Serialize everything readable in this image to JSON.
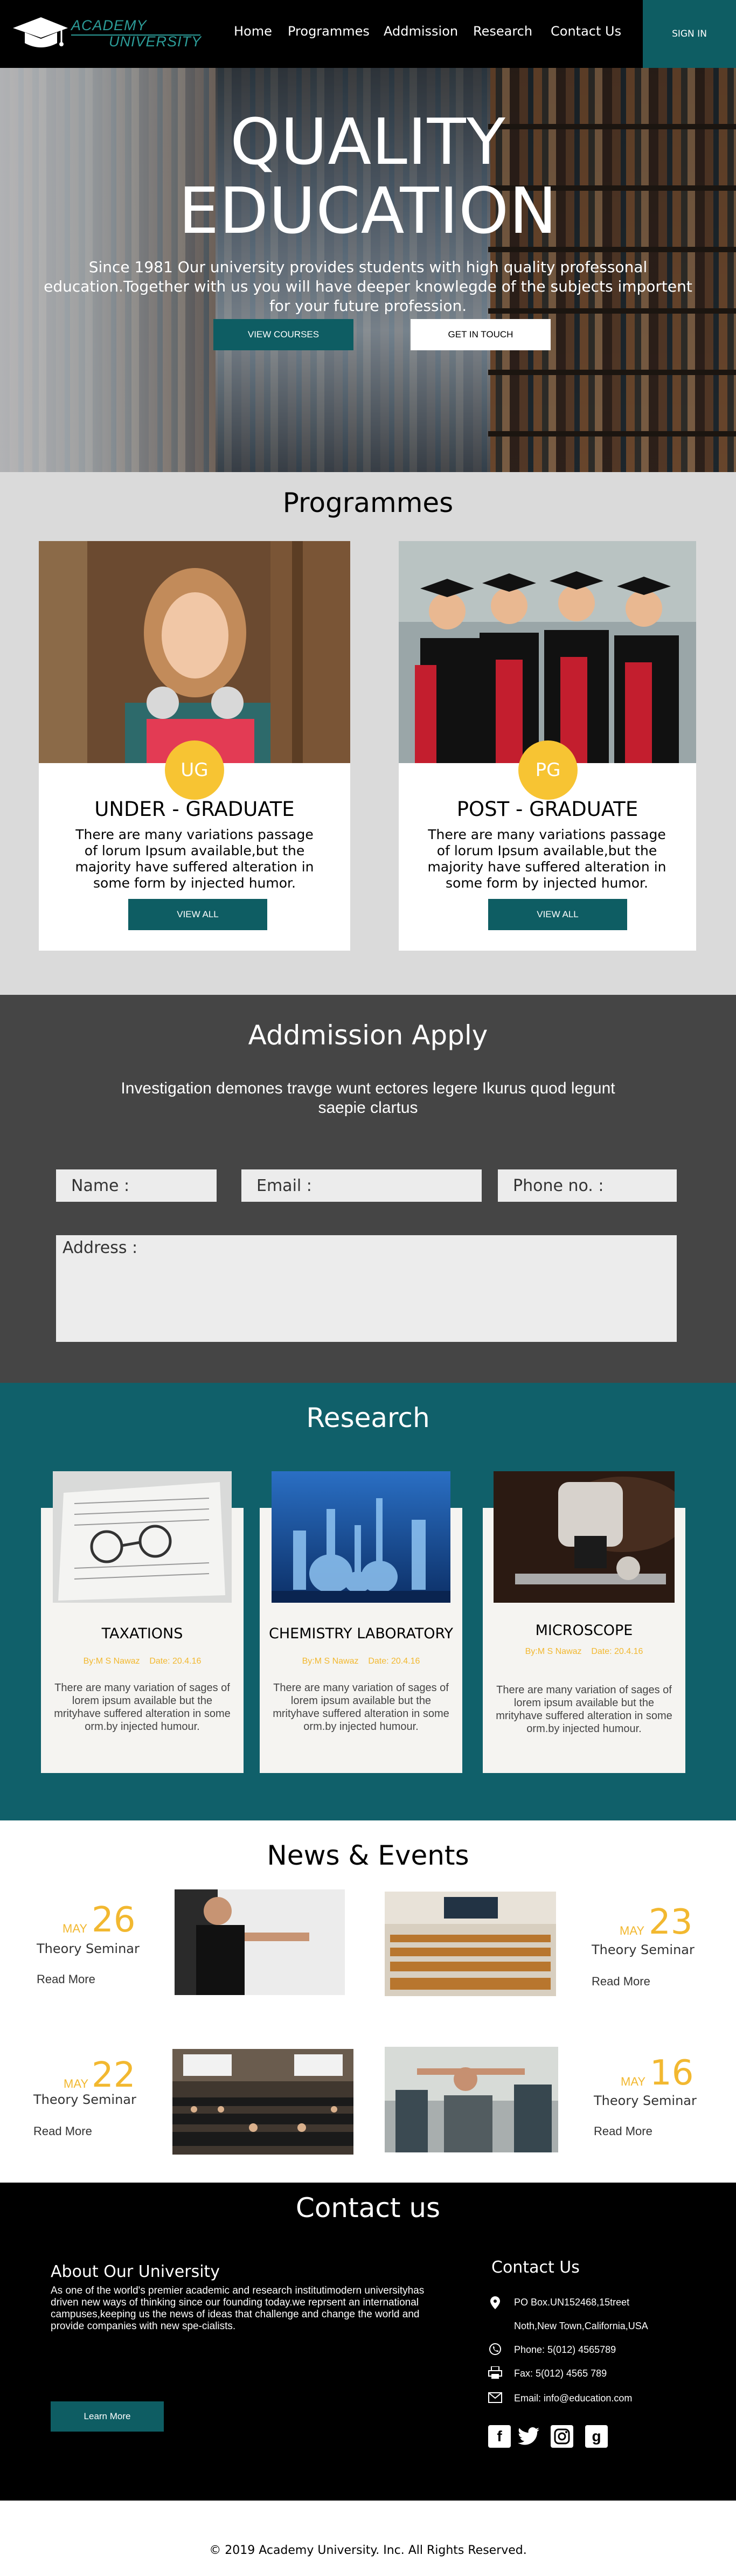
{
  "brand": {
    "line1": "ACADEMY",
    "line2": "UNIVERSITY",
    "accent": "#2c9c98",
    "primary": "#0e5d63",
    "yellow": "#f7c433"
  },
  "nav": {
    "home": "Home",
    "programmes": "Programmes",
    "admission": "Addmission",
    "research": "Research",
    "contact": "Contact Us",
    "signin": "SIGN IN"
  },
  "hero": {
    "title1": "QUALITY",
    "title2": "EDUCATION",
    "subtitle": "Since 1981 Our university provides students with high quality professonal education.Together with us you will have deeper knowlegde of the subjects importent for your future profession.",
    "btn_courses": "VIEW  COURSES",
    "btn_touch": "GET IN TOUCH"
  },
  "programmes": {
    "title": "Programmes",
    "cards": [
      {
        "badge": "UG",
        "title": "UNDER - GRADUATE",
        "text": "There are many variations passage of lorum Ipsum available,but the majority have suffered alteration in some form by injected humor.",
        "button": "VIEW ALL"
      },
      {
        "badge": "PG",
        "title": "POST - GRADUATE",
        "text": "There are many variations passage of lorum Ipsum available,but the majority have suffered alteration in some form by injected humor.",
        "button": "VIEW ALL"
      }
    ]
  },
  "admission": {
    "title": "Addmission Apply",
    "subtitle": "Investigation demones travge wunt ectores legere Ikurus quod legunt saepie clartus",
    "name_ph": "Name :",
    "email_ph": "Email :",
    "phone_ph": "Phone no. :",
    "address_ph": "Address :"
  },
  "research": {
    "title": "Research",
    "cards": [
      {
        "title": "TAXATIONS",
        "author": "By:M S Nawaz",
        "date": "Date: 20.4.16",
        "text": "There are many variation of sages of lorem ipsum available but the mrityhave suffered alteration in some orm.by injected humour."
      },
      {
        "title": "CHEMISTRY LABORATORY",
        "author": "By:M S Nawaz",
        "date": "Date: 20.4.16",
        "text": "There are many variation of sages of lorem ipsum available but the mrityhave suffered alteration in some orm.by injected humour."
      },
      {
        "title": "MICROSCOPE",
        "author": "By:M S Nawaz",
        "date": "Date: 20.4.16",
        "text": "There are many variation of sages of lorem ipsum available but the mrityhave suffered alteration in some orm.by injected humour."
      }
    ]
  },
  "news": {
    "title": "News & Events",
    "items": [
      {
        "month": "MAY",
        "day": "26",
        "title": "Theory Seminar",
        "read": "Read  More"
      },
      {
        "month": "MAY",
        "day": "23",
        "title": "Theory Seminar",
        "read": "Read  More"
      },
      {
        "month": "MAY",
        "day": "22",
        "title": "Theory Seminar",
        "read": "Read  More"
      },
      {
        "month": "MAY",
        "day": "16",
        "title": "Theory Seminar",
        "read": "Read  More"
      }
    ]
  },
  "contact": {
    "title": "Contact us",
    "about_title": "About Our University",
    "about_text": "As one of the world's premier academic and research institutimodern universityhas driven new ways of thinking since our founding today.we reprsent an international campuses,keeping us the news of ideas that challenge and change the world and provide companies with new spe-cialists.",
    "learn_more": "Learn More",
    "cu_title": "Contact Us",
    "address1": "PO Box.UN152468,15treet",
    "address2": "Noth,New Town,California,USA",
    "phone": "Phone: 5(012) 4565789",
    "fax": "Fax: 5(012) 4565 789",
    "email": "Email: info@education.com",
    "social": [
      "f",
      "t",
      "ig",
      "g"
    ]
  },
  "footer": {
    "copyright": "©  2019 Academy University. Inc. All Rights Reserved."
  }
}
